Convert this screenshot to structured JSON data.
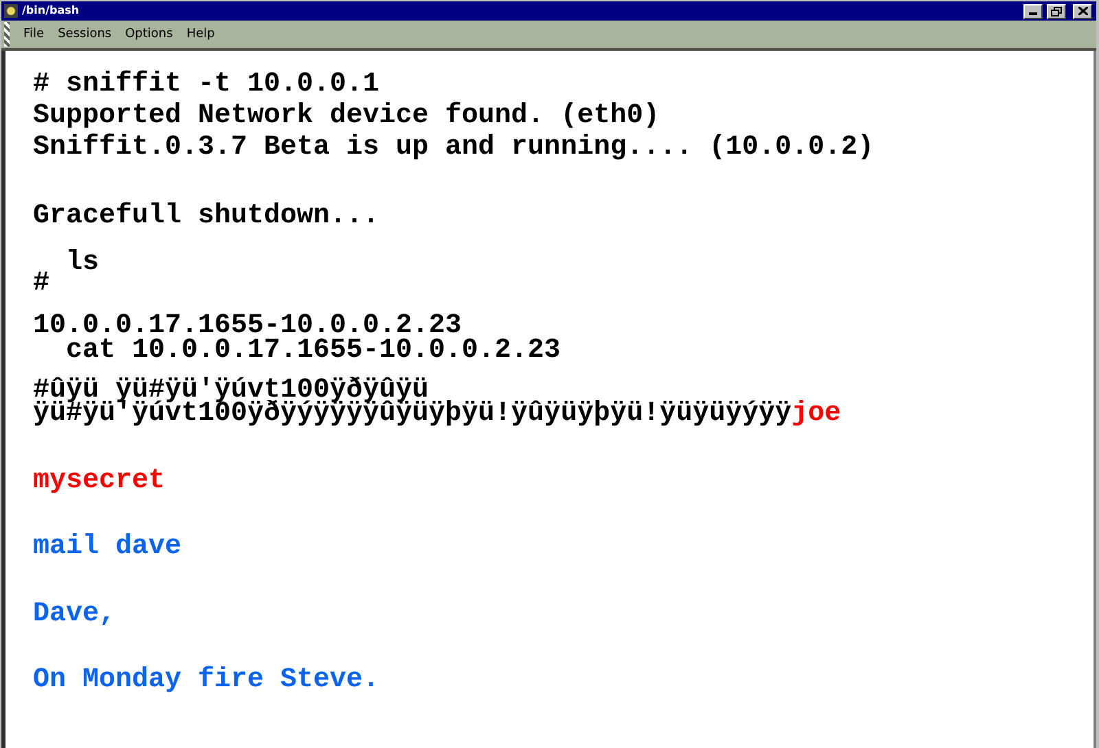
{
  "window": {
    "title": "/bin/bash"
  },
  "menu": [
    {
      "label": "File"
    },
    {
      "label": "Sessions"
    },
    {
      "label": "Options"
    },
    {
      "label": "Help"
    }
  ],
  "terminal": {
    "lines": [
      {
        "segments": [
          {
            "text": "# sniffit -t 10.0.0.1",
            "kind": "plain"
          }
        ]
      },
      {
        "segments": [
          {
            "text": "Supported Network device found. (eth0)",
            "kind": "plain"
          }
        ]
      },
      {
        "segments": [
          {
            "text": "Sniffit.0.3.7 Beta is up and running.... (10.0.0.2)",
            "kind": "plain"
          }
        ]
      },
      {
        "segments": [
          {
            "text": "Gracefull shutdown...",
            "kind": "plain"
          }
        ]
      },
      {
        "segments": [
          {
            "text": "  ls",
            "kind": "plain"
          }
        ]
      },
      {
        "segments": [
          {
            "text": "#",
            "kind": "plain"
          }
        ]
      },
      {
        "segments": [
          {
            "text": "10.0.0.17.1655-10.0.0.2.23",
            "kind": "plain"
          }
        ]
      },
      {
        "segments": [
          {
            "text": "  cat 10.0.0.17.1655-10.0.0.2.23",
            "kind": "plain"
          }
        ]
      },
      {
        "segments": [
          {
            "text": "#ûÿü ÿü#ÿü'ÿúvt100ÿðÿûÿü",
            "kind": "plain"
          }
        ]
      },
      {
        "segments": [
          {
            "text": "ÿü#ÿü'ÿúvt100ÿðÿýÿÿÿÿûÿüÿþÿü!ÿûÿüÿþÿü!ÿüÿüÿýÿÿ",
            "kind": "plain"
          },
          {
            "text": "joe",
            "kind": "secret"
          }
        ]
      },
      {
        "segments": [
          {
            "text": "mysecret",
            "kind": "secret"
          }
        ]
      },
      {
        "segments": [
          {
            "text": "mail dave",
            "kind": "mail"
          }
        ]
      },
      {
        "segments": [
          {
            "text": "Dave,",
            "kind": "mail"
          }
        ]
      },
      {
        "segments": [
          {
            "text": "On Monday fire Steve.",
            "kind": "mail"
          }
        ]
      }
    ]
  }
}
